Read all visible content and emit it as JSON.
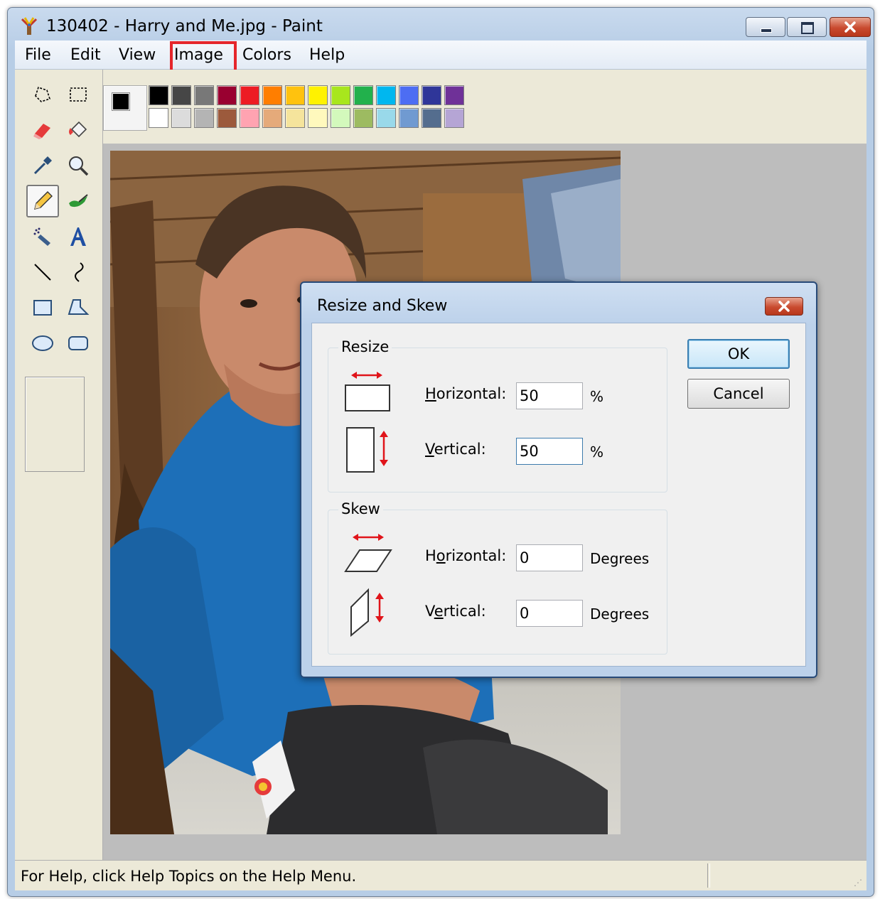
{
  "window": {
    "title": "130402 - Harry and Me.jpg - Paint"
  },
  "menu": {
    "items": [
      "File",
      "Edit",
      "View",
      "Image",
      "Colors",
      "Help"
    ],
    "highlighted": "Image",
    "highlight_color": "#e5262b"
  },
  "tools": [
    "free-form-select-icon",
    "select-icon",
    "eraser-icon",
    "fill-bucket-icon",
    "color-picker-icon",
    "magnifier-icon",
    "pencil-icon",
    "brush-icon",
    "airbrush-icon",
    "text-icon",
    "line-icon",
    "curve-icon",
    "rectangle-icon",
    "polygon-icon",
    "ellipse-icon",
    "rounded-rectangle-icon"
  ],
  "selected_tool": "pencil-icon",
  "palette": {
    "foreground": "#000000",
    "background": "#ffffff",
    "row1": [
      "#000000",
      "#464646",
      "#787878",
      "#990030",
      "#ed1c24",
      "#ff7e00",
      "#ffc20e",
      "#fff200",
      "#a8e61d",
      "#22b14c",
      "#00b7ef",
      "#4d6df3",
      "#2f3699",
      "#6f3198"
    ],
    "row2": [
      "#ffffff",
      "#dcdcdc",
      "#b4b4b4",
      "#9c5a3c",
      "#ffa3b1",
      "#e5aa7a",
      "#f5e49c",
      "#fff9bd",
      "#d3f9bc",
      "#9dbb61",
      "#99d9ea",
      "#709ad1",
      "#546d8e",
      "#b5a5d5"
    ]
  },
  "status": {
    "text": "For Help, click Help Topics on the Help Menu."
  },
  "dialog": {
    "title": "Resize and Skew",
    "resize": {
      "label": "Resize",
      "horizontal_label_prefix": "",
      "horizontal_label_mnemonic": "H",
      "horizontal_label_rest": "orizontal:",
      "horizontal_value": "50",
      "horizontal_unit": "%",
      "vertical_label_mnemonic": "V",
      "vertical_label_rest": "ertical:",
      "vertical_value": "50",
      "vertical_unit": "%"
    },
    "skew": {
      "label": "Skew",
      "horizontal_label_prefix": "H",
      "horizontal_label_mnemonic": "o",
      "horizontal_label_rest": "rizontal:",
      "horizontal_value": "0",
      "horizontal_unit": "Degrees",
      "vertical_label_prefix": "V",
      "vertical_label_mnemonic": "e",
      "vertical_label_rest": "rtical:",
      "vertical_value": "0",
      "vertical_unit": "Degrees"
    },
    "ok_label": "OK",
    "cancel_label": "Cancel"
  }
}
